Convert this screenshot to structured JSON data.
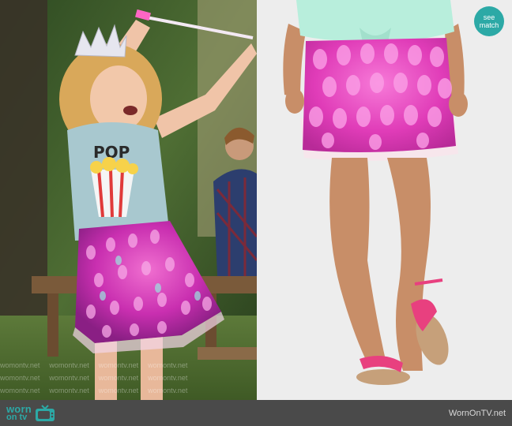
{
  "badge": {
    "line1": "see",
    "line2": "match",
    "color": "#2ca9a6"
  },
  "watermark": "womontv.net",
  "footer": {
    "logo_line1": "worn",
    "logo_line2": "on tv",
    "icon": "tv-icon",
    "site": "WornOnTV.net",
    "bg_color": "#4a4a4a",
    "logo_color": "#2ca9a6"
  }
}
